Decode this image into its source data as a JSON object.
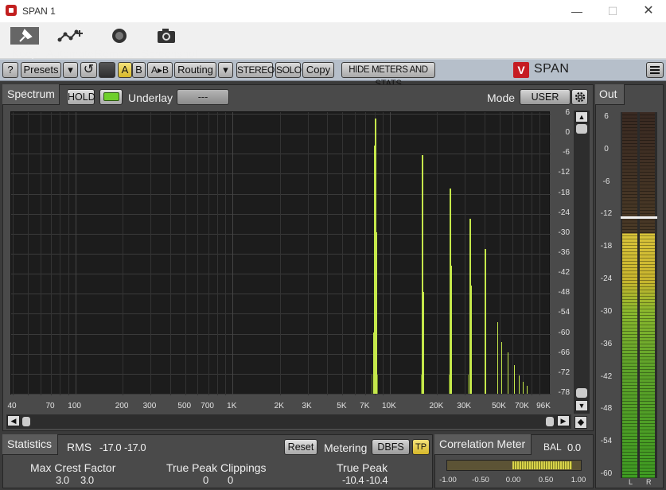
{
  "window": {
    "title": "SPAN 1",
    "minimize": "—",
    "maximize": "☐",
    "close": "✕"
  },
  "host_toolbar": {
    "keep_open": "Keep open",
    "automate": "Automate",
    "remote": "Remote",
    "screenshot": "Screenshot"
  },
  "plugin_toolbar": {
    "help": "?",
    "presets": "Presets",
    "dropdown": "▾",
    "undo": "↺",
    "a": "A",
    "b": "B",
    "a_to_b": "A▸B",
    "routing": "Routing",
    "stereo": "STEREO",
    "solo": "SOLO",
    "copy": "Copy",
    "hide_meters": "HIDE METERS AND STATS",
    "logo_mark": "V",
    "logo_text": "SPAN"
  },
  "spectrum": {
    "tab": "Spectrum",
    "hold": "HOLD",
    "underlay_label": "Underlay",
    "underlay_value": "---",
    "mode_label": "Mode",
    "mode_value": "USER",
    "db_scale": [
      "6",
      "0",
      "-6",
      "-12",
      "-18",
      "-24",
      "-30",
      "-36",
      "-42",
      "-48",
      "-54",
      "-60",
      "-66",
      "-72",
      "-78"
    ],
    "freq_scale": [
      "40",
      "70",
      "100",
      "200",
      "300",
      "500",
      "700",
      "1K",
      "2K",
      "3K",
      "5K",
      "7K",
      "10K",
      "20K",
      "30K",
      "50K",
      "70K",
      "96K"
    ]
  },
  "output": {
    "tab": "Out",
    "scale": [
      "6",
      "0",
      "-6",
      "-12",
      "-18",
      "-24",
      "-30",
      "-36",
      "-42",
      "-48",
      "-54",
      "-60"
    ],
    "left_label": "L",
    "right_label": "R",
    "peak_hold_db": -12.5,
    "level_db": -15.5
  },
  "statistics": {
    "tab": "Statistics",
    "rms_label": "RMS",
    "rms_left": "-17.0",
    "rms_right": "-17.0",
    "reset": "Reset",
    "metering_label": "Metering",
    "metering_value": "DBFS",
    "tp": "TP",
    "max_crest_label": "Max Crest Factor",
    "max_crest_left": "3.0",
    "max_crest_right": "3.0",
    "tp_clip_label": "True Peak Clippings",
    "tp_clip_left": "0",
    "tp_clip_right": "0",
    "true_peak_label": "True Peak",
    "true_peak_left": "-10.4",
    "true_peak_right": "-10.4"
  },
  "correlation": {
    "title": "Correlation Meter",
    "bal_label": "BAL",
    "bal_value": "0.0",
    "scale": [
      "-1.00",
      "-0.50",
      "0.00",
      "0.50",
      "1.00"
    ]
  },
  "colors": {
    "spectrum_line": "#c5e84b",
    "panel_bg": "#4a4a4a",
    "toolbar_bg": "#b6bfca",
    "meter_green": "#5fa32a",
    "meter_yellow": "#d9c43a"
  }
}
